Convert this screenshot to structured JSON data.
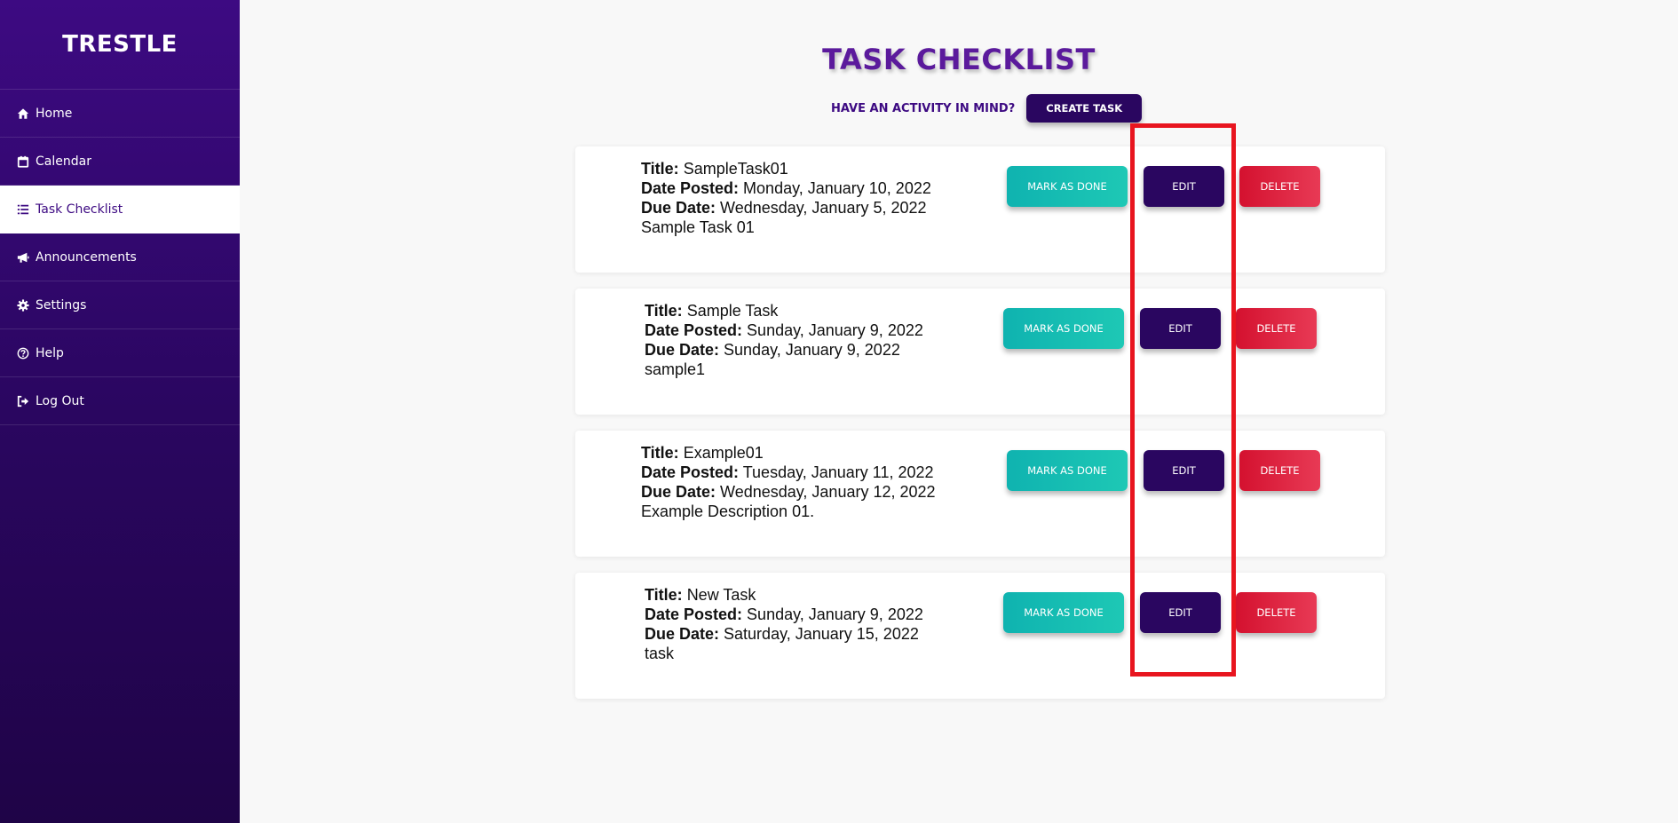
{
  "brand": "TRESTLE",
  "sidebar": {
    "items": [
      {
        "label": "Home",
        "icon": "home-icon"
      },
      {
        "label": "Calendar",
        "icon": "calendar-icon"
      },
      {
        "label": "Task Checklist",
        "icon": "list-icon",
        "active": true
      },
      {
        "label": "Announcements",
        "icon": "megaphone-icon"
      },
      {
        "label": "Settings",
        "icon": "gear-icon"
      },
      {
        "label": "Help",
        "icon": "question-circle-icon"
      },
      {
        "label": "Log Out",
        "icon": "logout-icon"
      }
    ]
  },
  "main": {
    "title": "TASK CHECKLIST",
    "prompt": "HAVE AN ACTIVITY IN MIND?",
    "create_label": "CREATE TASK",
    "labels": {
      "title": "Title:",
      "date_posted": "Date Posted:",
      "due_date": "Due Date:"
    },
    "buttons": {
      "done": "MARK AS DONE",
      "edit": "EDIT",
      "delete": "DELETE"
    },
    "tasks": [
      {
        "title": "SampleTask01",
        "date_posted": "Monday, January 10, 2022",
        "due_date": "Wednesday, January 5, 2022",
        "description": "Sample Task 01"
      },
      {
        "title": "Sample Task",
        "date_posted": "Sunday, January 9, 2022",
        "due_date": "Sunday, January 9, 2022",
        "description": "sample1"
      },
      {
        "title": "Example01",
        "date_posted": "Tuesday, January 11, 2022",
        "due_date": "Wednesday, January 12, 2022",
        "description": "Example Description 01."
      },
      {
        "title": "New Task",
        "date_posted": "Sunday, January 9, 2022",
        "due_date": "Saturday, January 15, 2022",
        "description": "task"
      }
    ]
  },
  "colors": {
    "sidebar": "#3d0a82",
    "primary": "#2a0660",
    "title": "#5b1a9c",
    "done": "#1ec8b5",
    "delete": "#e83a55",
    "highlight": "#e8151f"
  }
}
